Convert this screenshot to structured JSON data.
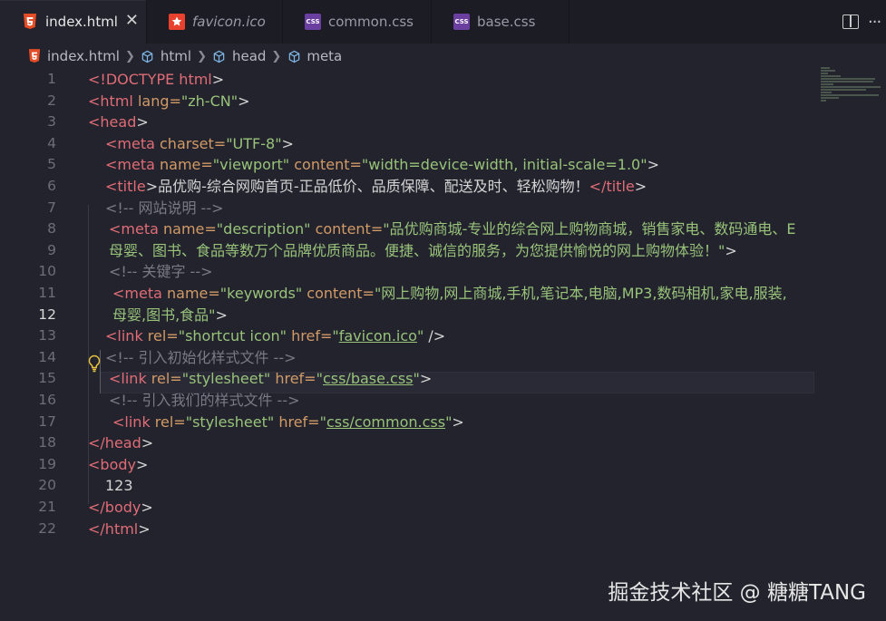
{
  "tabs": [
    {
      "label": "index.html",
      "icon": "html5-icon",
      "active": true,
      "close": "✕"
    },
    {
      "label": "favicon.ico",
      "icon": "star-icon",
      "active": false
    },
    {
      "label": "common.css",
      "icon": "css-icon",
      "active": false
    },
    {
      "label": "base.css",
      "icon": "css-icon",
      "active": false
    }
  ],
  "icon_text": {
    "css": "CSS"
  },
  "breadcrumb": [
    "index.html",
    "html",
    "head",
    "meta"
  ],
  "line_numbers": [
    "1",
    "2",
    "3",
    "4",
    "5",
    "6",
    "7",
    "8",
    "9",
    "10",
    "11",
    "12",
    "13",
    "14",
    "15",
    "16",
    "17",
    "18",
    "19",
    "20",
    "21",
    "22"
  ],
  "current_line": "12",
  "code": {
    "l1": {
      "t1": "<!DOCTYPE html",
      "p1": ">"
    },
    "l2": {
      "t1": "<html",
      "a1": " lang=",
      "s1": "\"zh-CN\"",
      "p1": ">"
    },
    "l3": {
      "t1": "<head",
      "p1": ">"
    },
    "l4": {
      "t1": "<meta",
      "a1": " charset=",
      "s1": "\"UTF-8\"",
      "p1": ">"
    },
    "l5": {
      "t1": "<meta",
      "a1": " name=",
      "s1": "\"viewport\"",
      "a2": " content=",
      "s2": "\"width=device-width, initial-scale=1.0\"",
      "p1": ">"
    },
    "l6": {
      "t1": "<title",
      "p1": ">品优购-综合网购首页-正品低价、品质保障、配送及时、轻松购物！",
      "t2": "</title",
      "p2": ">"
    },
    "l7": {
      "c1": "<!-- 网站说明 -->"
    },
    "l8": {
      "t1": "<meta",
      "a1": " name=",
      "s1": "\"description\"",
      "a2": " content=",
      "s2": "\"品优购商城-专业的综合网上购物商城，销售家电、数码通电、E"
    },
    "l9": {
      "s1": "母婴、图书、食品等数万个品牌优质商品。便捷、诚信的服务，为您提供愉悦的网上购物体验！\"",
      "p1": ">"
    },
    "l10": {
      "c1": "<!-- 关键字 -->"
    },
    "l11": {
      "t1": "<meta",
      "a1": " name=",
      "s1": "\"keywords\"",
      "a2": " content=",
      "s2": "\"网上购物,网上商城,手机,笔记本,电脑,MP3,数码相机,家电,服装,"
    },
    "l12": {
      "s1": "母婴,图书,食品\"",
      "p1": ">"
    },
    "l13": {
      "t1": "<link",
      "a1": " rel=",
      "s1": "\"shortcut icon\"",
      "a2": " href=",
      "s2a": "\"",
      "s2b": "favicon.ico",
      "s2c": "\"",
      "p1": " />"
    },
    "l14": {
      "c1": "<!-- 引入初始化样式文件 -->"
    },
    "l15": {
      "t1": "<link",
      "a1": " rel=",
      "s1": "\"stylesheet\"",
      "a2": " href=",
      "s2a": "\"",
      "s2b": "css/base.css",
      "s2c": "\"",
      "p1": ">"
    },
    "l16": {
      "c1": "<!-- 引入我们的样式文件 -->"
    },
    "l17": {
      "t1": "<link",
      "a1": " rel=",
      "s1": "\"stylesheet\"",
      "a2": " href=",
      "s2a": "\"",
      "s2b": "css/common.css",
      "s2c": "\"",
      "p1": ">"
    },
    "l18": {
      "t1": "</head",
      "p1": ">"
    },
    "l19": {
      "t1": "<body",
      "p1": ">"
    },
    "l20": {
      "p1": "123"
    },
    "l21": {
      "t1": "</body",
      "p1": ">"
    },
    "l22": {
      "t1": "</html",
      "p1": ">"
    }
  },
  "watermark": "掘金技术社区 @ 糖糖TANG",
  "colors": {
    "tag": "#e06c75",
    "attr": "#d19a66",
    "string": "#98c379",
    "comment": "#7a7a86",
    "background": "#23232e"
  }
}
